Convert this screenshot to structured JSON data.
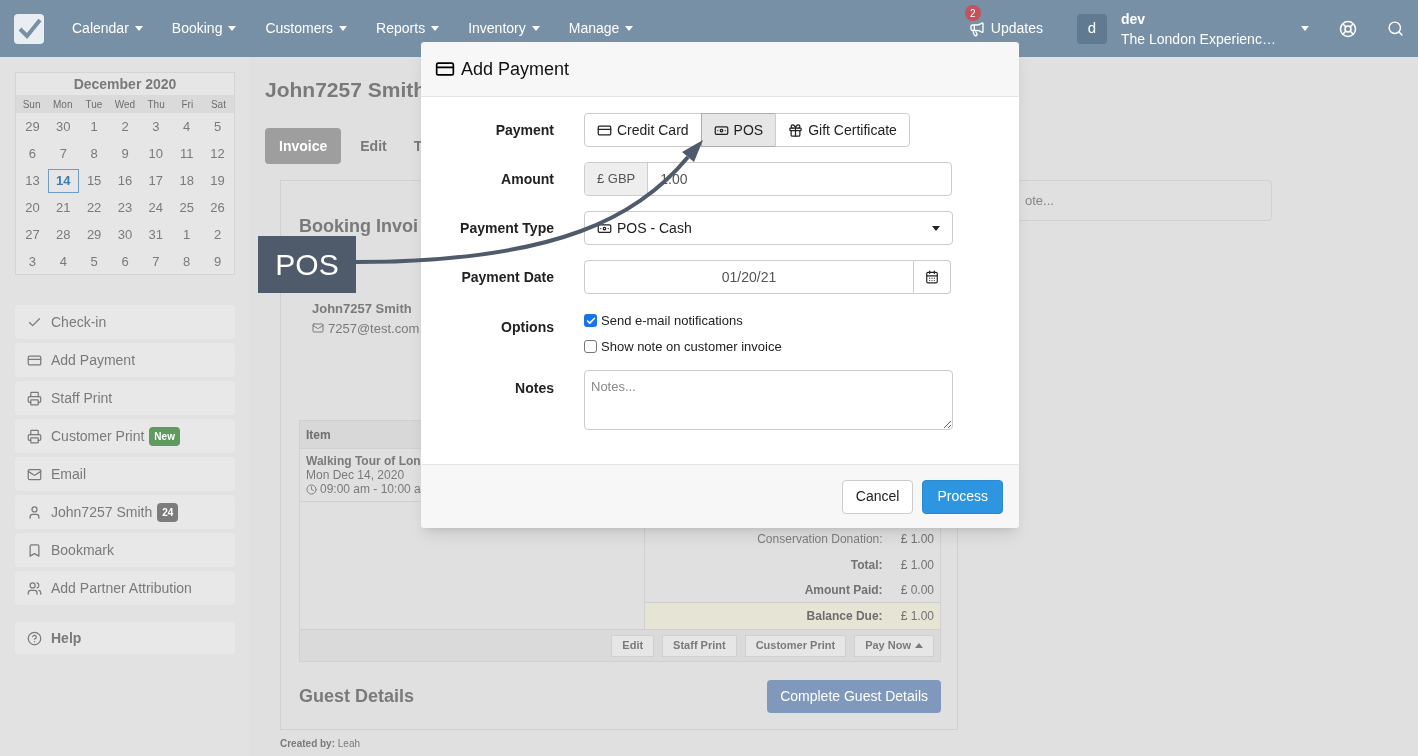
{
  "navbar": {
    "menus": [
      "Calendar",
      "Booking",
      "Customers",
      "Reports",
      "Inventory",
      "Manage"
    ],
    "updates": {
      "label": "Updates",
      "count": "2"
    },
    "user": {
      "avatar": "d",
      "name": "dev",
      "company": "The London Experienc…"
    }
  },
  "calendar": {
    "title": "December 2020",
    "weekdays": [
      "Sun",
      "Mon",
      "Tue",
      "Wed",
      "Thu",
      "Fri",
      "Sat"
    ],
    "weeks": [
      [
        {
          "day": "29",
          "selected": false
        },
        {
          "day": "30",
          "selected": false
        },
        {
          "day": "1",
          "selected": false
        },
        {
          "day": "2",
          "selected": false
        },
        {
          "day": "3",
          "selected": false
        },
        {
          "day": "4",
          "selected": false
        },
        {
          "day": "5",
          "selected": false
        }
      ],
      [
        {
          "day": "6",
          "selected": false
        },
        {
          "day": "7",
          "selected": false
        },
        {
          "day": "8",
          "selected": false
        },
        {
          "day": "9",
          "selected": false
        },
        {
          "day": "10",
          "selected": false
        },
        {
          "day": "11",
          "selected": false
        },
        {
          "day": "12",
          "selected": false
        }
      ],
      [
        {
          "day": "13",
          "selected": false
        },
        {
          "day": "14",
          "selected": true
        },
        {
          "day": "15",
          "selected": false
        },
        {
          "day": "16",
          "selected": false
        },
        {
          "day": "17",
          "selected": false
        },
        {
          "day": "18",
          "selected": false
        },
        {
          "day": "19",
          "selected": false
        }
      ],
      [
        {
          "day": "20",
          "selected": false
        },
        {
          "day": "21",
          "selected": false
        },
        {
          "day": "22",
          "selected": false
        },
        {
          "day": "23",
          "selected": false
        },
        {
          "day": "24",
          "selected": false
        },
        {
          "day": "25",
          "selected": false
        },
        {
          "day": "26",
          "selected": false
        }
      ],
      [
        {
          "day": "27",
          "selected": false
        },
        {
          "day": "28",
          "selected": false
        },
        {
          "day": "29",
          "selected": false
        },
        {
          "day": "30",
          "selected": false
        },
        {
          "day": "31",
          "selected": false
        },
        {
          "day": "1",
          "selected": false
        },
        {
          "day": "2",
          "selected": false
        }
      ],
      [
        {
          "day": "3",
          "selected": false
        },
        {
          "day": "4",
          "selected": false
        },
        {
          "day": "5",
          "selected": false
        },
        {
          "day": "6",
          "selected": false
        },
        {
          "day": "7",
          "selected": false
        },
        {
          "day": "8",
          "selected": false
        },
        {
          "day": "9",
          "selected": false
        }
      ]
    ]
  },
  "sidebar": {
    "items": [
      {
        "kind": "check",
        "label": "Check-in"
      },
      {
        "kind": "card",
        "label": "Add Payment"
      },
      {
        "kind": "print",
        "label": "Staff Print"
      },
      {
        "kind": "print",
        "label": "Customer Print",
        "badge": {
          "text": "New",
          "color": "#5f9a5f"
        }
      },
      {
        "kind": "mail",
        "label": "Email"
      },
      {
        "kind": "user",
        "label": "John7257 Smith",
        "badge": {
          "text": "24",
          "color": "#7c7c7c"
        }
      },
      {
        "kind": "bookmark",
        "label": "Bookmark"
      },
      {
        "kind": "users",
        "label": "Add Partner Attribution"
      }
    ],
    "help": "Help"
  },
  "booking": {
    "title": "John7257 Smith",
    "tabs": [
      {
        "label": "Invoice",
        "selected": true
      },
      {
        "label": "Edit",
        "selected": false
      },
      {
        "label": "T",
        "selected": false
      }
    ],
    "invoice_title": "Booking Invoi",
    "customer": {
      "name": "John7257 Smith",
      "email": "7257@test.com"
    },
    "table": {
      "column": "Item",
      "row": {
        "title": "Walking Tour of Lon",
        "date": "Mon Dec 14, 2020",
        "time": "09:00 am - 10:00 a"
      }
    },
    "totals": [
      {
        "kind": "plain",
        "label": "Conservation Donation:",
        "value": "£ 1.00"
      },
      {
        "kind": "bold",
        "label": "Total:",
        "value": "£ 1.00"
      },
      {
        "kind": "bold",
        "label": "Amount Paid:",
        "value": "£ 0.00"
      },
      {
        "kind": "due",
        "label": "Balance Due:",
        "value": "£ 1.00"
      }
    ],
    "actions": [
      "Edit",
      "Staff Print",
      "Customer Print",
      "Pay Now"
    ],
    "guest_title": "Guest Details",
    "guest_button": "Complete Guest Details",
    "created_by": {
      "label": "Created by:",
      "name": "Leah"
    }
  },
  "note": {
    "placeholder": "ote..."
  },
  "modal": {
    "title": "Add Payment",
    "payment": {
      "label": "Payment",
      "options": [
        {
          "kind": "card",
          "label": "Credit Card",
          "selected": false
        },
        {
          "kind": "cash",
          "label": "POS",
          "selected": true
        },
        {
          "kind": "gift",
          "label": "Gift Certificate",
          "selected": false
        }
      ]
    },
    "amount": {
      "label": "Amount",
      "currency": "£ GBP",
      "value": "1.00"
    },
    "payment_type": {
      "label": "Payment Type",
      "value": "POS - Cash"
    },
    "payment_date": {
      "label": "Payment Date",
      "value": "01/20/21"
    },
    "options": {
      "label": "Options",
      "items": [
        {
          "label": "Send e-mail notifications",
          "checked": true
        },
        {
          "label": "Show note on customer invoice",
          "checked": false
        }
      ]
    },
    "notes": {
      "label": "Notes",
      "placeholder": "Notes..."
    },
    "buttons": {
      "cancel": "Cancel",
      "process": "Process"
    }
  },
  "callout": {
    "text": "POS"
  }
}
